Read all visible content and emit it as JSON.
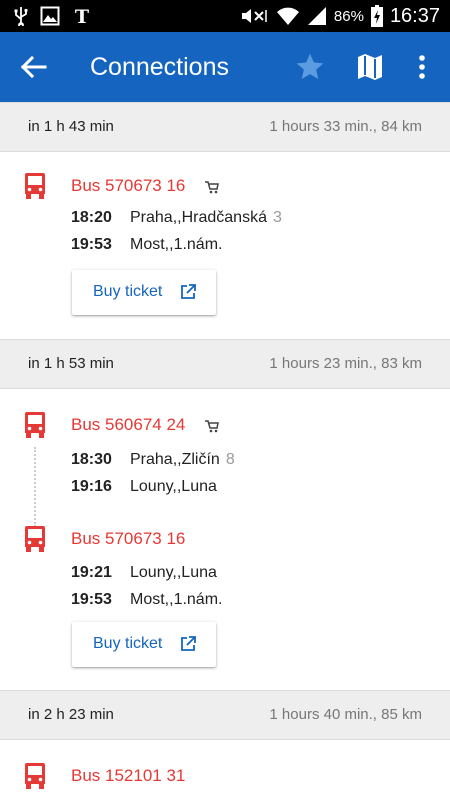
{
  "status_bar": {
    "battery": "86%",
    "time": "16:37",
    "icons": [
      "usb-icon",
      "image-icon",
      "nyt-icon",
      "mute-icon",
      "wifi-icon",
      "signal-icon",
      "battery-icon"
    ]
  },
  "app_bar": {
    "title": "Connections",
    "icons": [
      "back-arrow-icon",
      "star-icon",
      "map-icon",
      "more-vert-icon"
    ]
  },
  "colors": {
    "primary": "#1565c0",
    "bus_red": "#e53935",
    "separator_bg": "#eeeeee"
  },
  "connections": [
    {
      "departure_in": "in 1 h 43 min",
      "summary": "1 hours 33 min., 84 km",
      "legs": [
        {
          "bus": "Bus 570673 16",
          "buyable": true,
          "stops": [
            {
              "time": "18:20",
              "name": "Praha,,Hradčanská",
              "platform": "3"
            },
            {
              "time": "19:53",
              "name": "Most,,1.nám.",
              "platform": ""
            }
          ]
        }
      ],
      "buy_label": "Buy ticket"
    },
    {
      "departure_in": "in 1 h 53 min",
      "summary": "1 hours 23 min., 83 km",
      "legs": [
        {
          "bus": "Bus 560674 24",
          "buyable": true,
          "stops": [
            {
              "time": "18:30",
              "name": "Praha,,Zličín",
              "platform": "8"
            },
            {
              "time": "19:16",
              "name": "Louny,,Luna",
              "platform": ""
            }
          ]
        },
        {
          "bus": "Bus 570673 16",
          "buyable": false,
          "stops": [
            {
              "time": "19:21",
              "name": "Louny,,Luna",
              "platform": ""
            },
            {
              "time": "19:53",
              "name": "Most,,1.nám.",
              "platform": ""
            }
          ]
        }
      ],
      "buy_label": "Buy ticket"
    },
    {
      "departure_in": "in 2 h 23 min",
      "summary": "1 hours 40 min., 85 km",
      "legs": [
        {
          "bus": "Bus 152101 31",
          "buyable": false,
          "stops": []
        }
      ]
    }
  ]
}
